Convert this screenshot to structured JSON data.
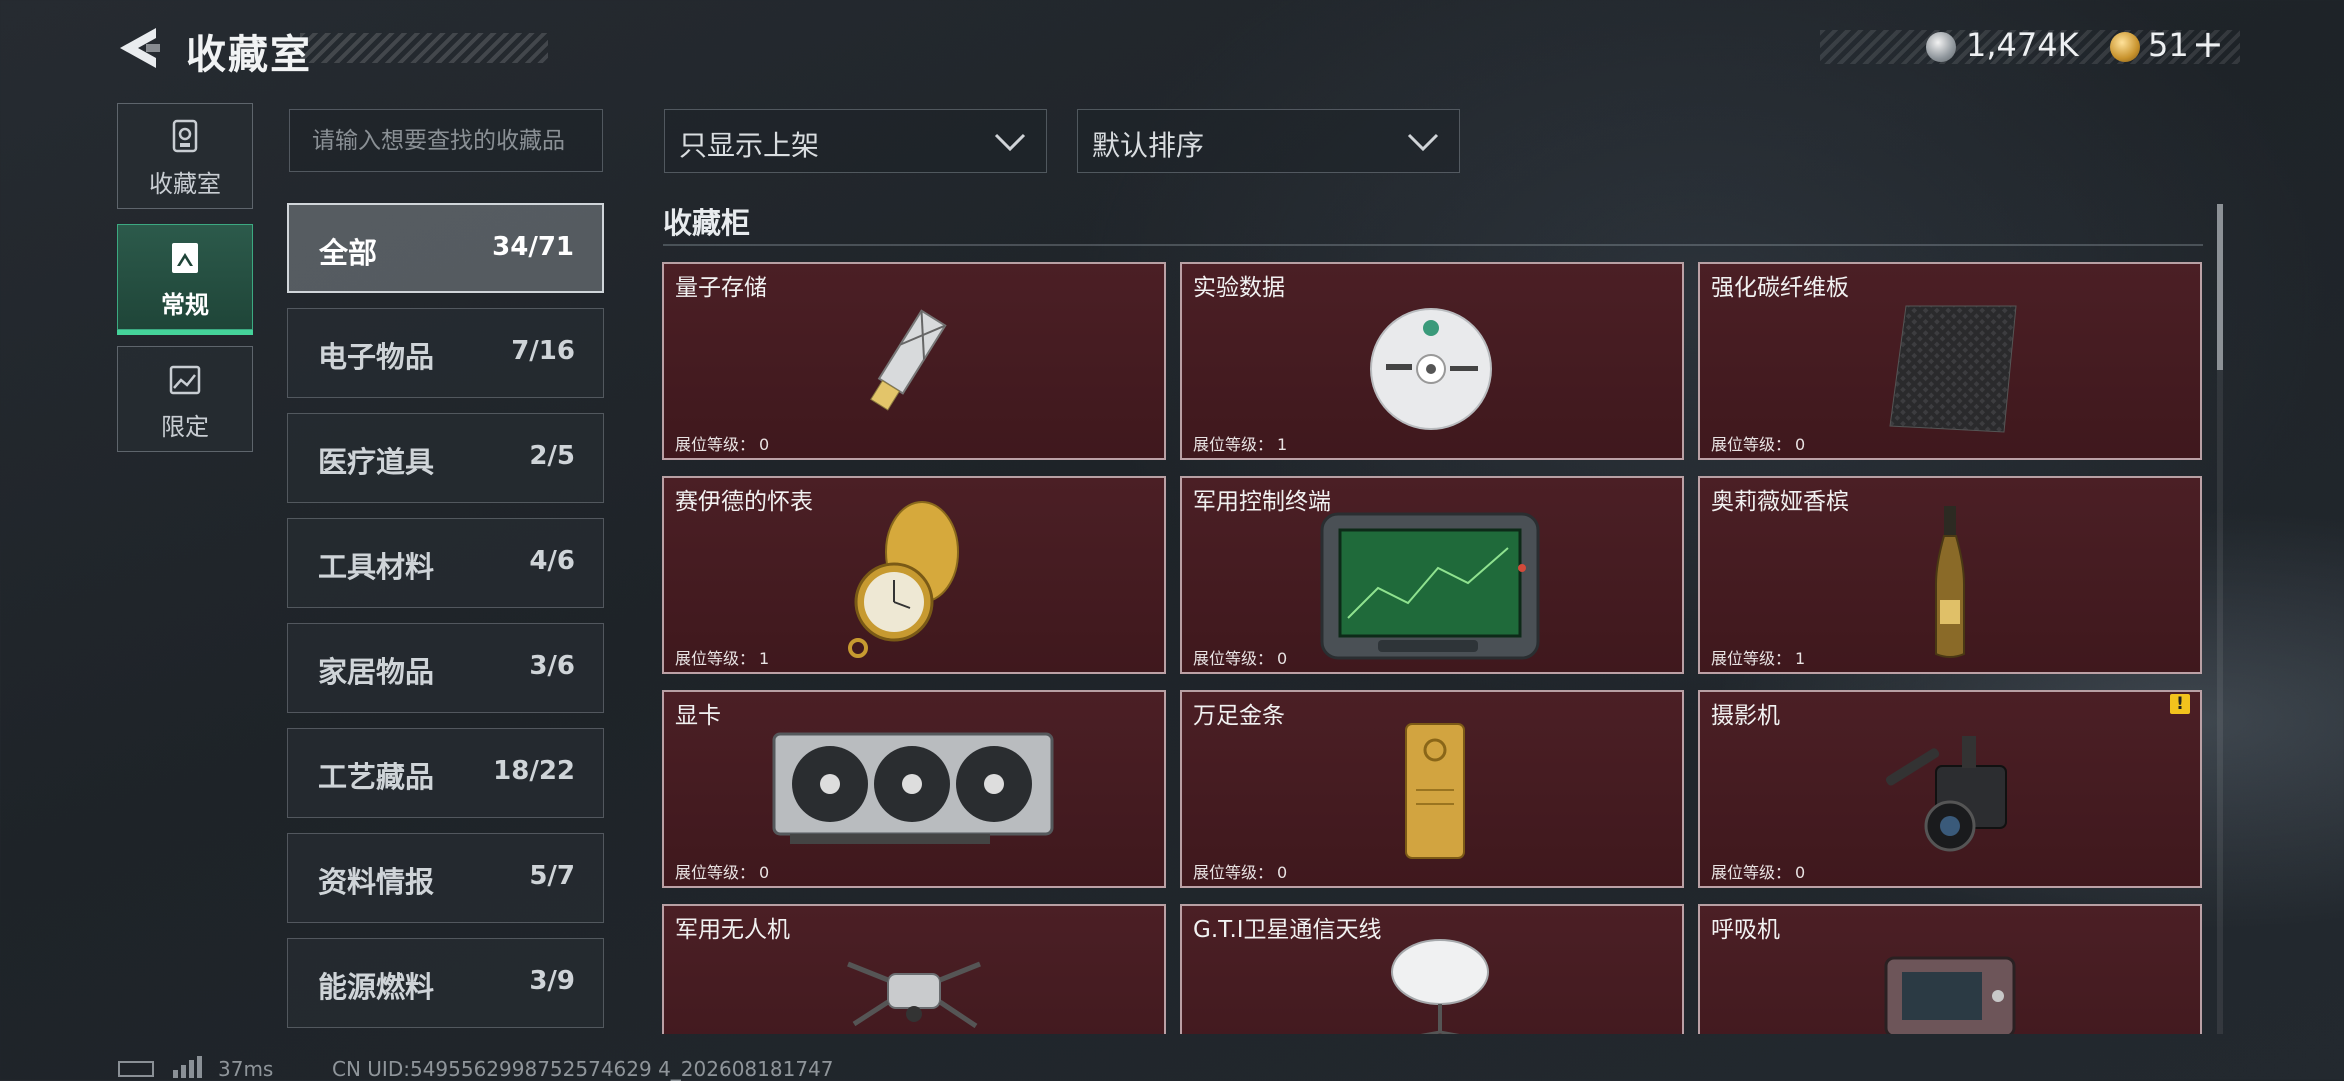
{
  "header": {
    "title": "收藏室",
    "currency_1": "1,474K",
    "currency_2": "51",
    "plus": "+"
  },
  "nav": [
    {
      "label": "收藏室",
      "icon": "trophy-icon"
    },
    {
      "label": "常规",
      "icon": "frame-icon",
      "active": true
    },
    {
      "label": "限定",
      "icon": "picture-icon"
    }
  ],
  "search": {
    "placeholder": "请输入想要查找的收藏品"
  },
  "filters": {
    "display": "只显示上架",
    "sort": "默认排序"
  },
  "categories": [
    {
      "name": "全部",
      "count": "34/71",
      "active": true
    },
    {
      "name": "电子物品",
      "count": "7/16"
    },
    {
      "name": "医疗道具",
      "count": "2/5"
    },
    {
      "name": "工具材料",
      "count": "4/6"
    },
    {
      "name": "家居物品",
      "count": "3/6"
    },
    {
      "name": "工艺藏品",
      "count": "18/22"
    },
    {
      "name": "资料情报",
      "count": "5/7"
    },
    {
      "name": "能源燃料",
      "count": "3/9"
    }
  ],
  "section": {
    "title": "收藏柜",
    "level_label": "展位等级："
  },
  "items": [
    {
      "name": "量子存储",
      "level": "0",
      "icon": "usb-drive-icon"
    },
    {
      "name": "实验数据",
      "level": "1",
      "icon": "disc-icon"
    },
    {
      "name": "强化碳纤维板",
      "level": "0",
      "icon": "carbon-plate-icon"
    },
    {
      "name": "赛伊德的怀表",
      "level": "1",
      "icon": "pocket-watch-icon"
    },
    {
      "name": "军用控制终端",
      "level": "0",
      "icon": "terminal-icon"
    },
    {
      "name": "奥莉薇娅香槟",
      "level": "1",
      "icon": "champagne-icon"
    },
    {
      "name": "显卡",
      "level": "0",
      "icon": "graphics-card-icon"
    },
    {
      "name": "万足金条",
      "level": "0",
      "icon": "gold-bar-icon"
    },
    {
      "name": "摄影机",
      "level": "0",
      "icon": "video-camera-icon",
      "warning": "!"
    },
    {
      "name": "军用无人机",
      "level": "",
      "icon": "drone-icon"
    },
    {
      "name": "G.T.I卫星通信天线",
      "level": "",
      "icon": "satellite-dish-icon"
    },
    {
      "name": "呼吸机",
      "level": "",
      "icon": "ventilator-icon"
    }
  ],
  "footer": {
    "ping": "37ms",
    "uid": "CN UID:5495562998752574629 4_202608181747"
  }
}
